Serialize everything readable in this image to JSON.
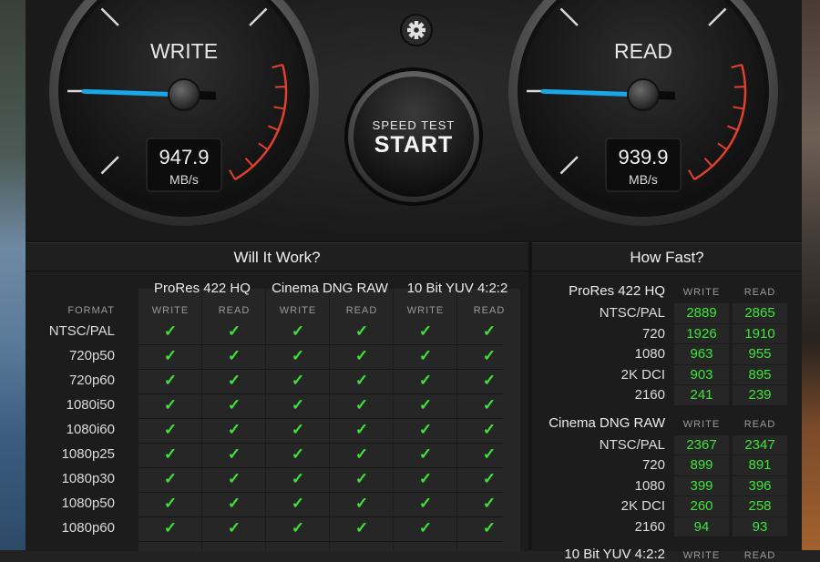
{
  "write_gauge": {
    "title": "WRITE",
    "value": "947.9",
    "unit": "MB/s",
    "needle_fraction": 0.02
  },
  "read_gauge": {
    "title": "READ",
    "value": "939.9",
    "unit": "MB/s",
    "needle_fraction": 0.02
  },
  "start_button": {
    "line1": "SPEED TEST",
    "line2": "START"
  },
  "settings_icon": "gear-icon",
  "colors": {
    "accent_needle": "#1aa7e8",
    "check_green": "#3ee43a",
    "redline": "#e0402f"
  },
  "will_it_work": {
    "title": "Will It Work?",
    "format_label": "FORMAT",
    "groups": [
      {
        "name": "ProRes 422 HQ",
        "write": "WRITE",
        "read": "READ"
      },
      {
        "name": "Cinema DNG RAW",
        "write": "WRITE",
        "read": "READ"
      },
      {
        "name": "10 Bit YUV 4:2:2",
        "write": "WRITE",
        "read": "READ"
      }
    ],
    "rows": [
      "NTSC/PAL",
      "720p50",
      "720p60",
      "1080i50",
      "1080i60",
      "1080p25",
      "1080p30",
      "1080p50",
      "1080p60"
    ],
    "check_glyph": "✓"
  },
  "how_fast": {
    "title": "How Fast?",
    "groups": [
      {
        "name": "ProRes 422 HQ",
        "write": "WRITE",
        "read": "READ",
        "rows": [
          {
            "label": "NTSC/PAL",
            "write": "2889",
            "read": "2865"
          },
          {
            "label": "720",
            "write": "1926",
            "read": "1910"
          },
          {
            "label": "1080",
            "write": "963",
            "read": "955"
          },
          {
            "label": "2K DCI",
            "write": "903",
            "read": "895"
          },
          {
            "label": "2160",
            "write": "241",
            "read": "239"
          }
        ]
      },
      {
        "name": "Cinema DNG RAW",
        "write": "WRITE",
        "read": "READ",
        "rows": [
          {
            "label": "NTSC/PAL",
            "write": "2367",
            "read": "2347"
          },
          {
            "label": "720",
            "write": "899",
            "read": "891"
          },
          {
            "label": "1080",
            "write": "399",
            "read": "396"
          },
          {
            "label": "2K DCI",
            "write": "260",
            "read": "258"
          },
          {
            "label": "2160",
            "write": "94",
            "read": "93"
          }
        ]
      },
      {
        "name": "10 Bit YUV 4:2:2",
        "write": "WRITE",
        "read": "READ",
        "rows": []
      }
    ]
  }
}
